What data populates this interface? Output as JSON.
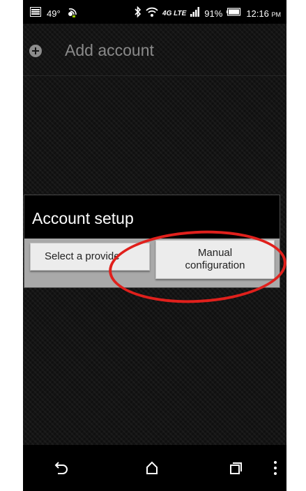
{
  "status_bar": {
    "temperature": "49°",
    "network_type": "4G LTE",
    "battery_percent": "91%",
    "time": "12:16",
    "ampm": "PM",
    "icons": [
      "notification-icon",
      "weather-icon",
      "bluetooth-icon",
      "wifi-icon",
      "lte-icon",
      "signal-icon",
      "battery-icon"
    ]
  },
  "action_bar": {
    "icon": "add-circle-icon",
    "title": "Add account"
  },
  "dialog": {
    "title": "Account setup",
    "buttons": {
      "provider_label": "Select a provide",
      "manual_line1": "Manual",
      "manual_line2": "configuration"
    }
  },
  "annotation": {
    "color": "#e0201c",
    "target": "Manual configuration"
  },
  "nav_bar": {
    "icons": [
      "back-icon",
      "home-icon",
      "recent-apps-icon",
      "overflow-menu-icon"
    ]
  }
}
